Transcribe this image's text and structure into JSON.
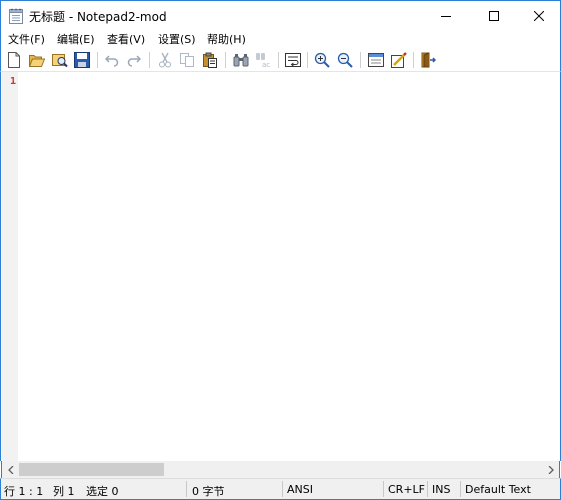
{
  "window": {
    "title": "无标题 - Notepad2-mod"
  },
  "menu": {
    "items": [
      "文件(F)",
      "编辑(E)",
      "查看(V)",
      "设置(S)",
      "帮助(H)"
    ]
  },
  "toolbar": {
    "icons": [
      "new-file-icon",
      "open-file-icon",
      "browse-icon",
      "save-icon",
      "undo-icon",
      "redo-icon",
      "cut-icon",
      "copy-icon",
      "paste-icon",
      "find-icon",
      "replace-icon",
      "word-wrap-icon",
      "zoom-in-icon",
      "zoom-out-icon",
      "scheme-icon",
      "settings-icon",
      "exit-icon"
    ]
  },
  "editor": {
    "line_number": "1",
    "content": ""
  },
  "status": {
    "position": "行 1 : 1",
    "column": "列 1",
    "selection": "选定 0",
    "bytes": "0 字节",
    "encoding": "ANSI",
    "line_endings": "CR+LF",
    "insert_mode": "INS",
    "scheme": "Default Text"
  },
  "colors": {
    "accent": "#2b7fd4",
    "line_number": "#e32b2b",
    "gutter": "#f2f2f2"
  }
}
